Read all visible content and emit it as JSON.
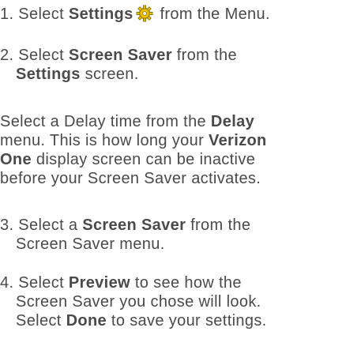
{
  "step1": {
    "prefix": "1. Select ",
    "bold": "Settings",
    "icon": "gear-icon",
    "suffix": " from the Menu."
  },
  "step2": {
    "line1_prefix": "2. Select ",
    "line1_bold": "Screen Saver",
    "line1_suffix": " from the",
    "line2_bold": "Settings",
    "line2_suffix": " screen."
  },
  "paragraph": {
    "l1_prefix": "Select a Delay time from the ",
    "l1_bold": "Delay",
    "l2_prefix": "menu. This is how long your ",
    "l2_bold": "Verizon",
    "l3_bold": "One",
    "l3_suffix": " display screen can be inactive",
    "l4": "before your Screen Saver activates."
  },
  "step3": {
    "line1_prefix": "3. Select a ",
    "line1_bold": "Screen Saver",
    "line1_suffix": " from the",
    "line2": "Screen Saver menu."
  },
  "step4": {
    "line1_prefix": "4. Select ",
    "line1_bold": "Preview",
    "line1_suffix": " to see how the",
    "line2": "Screen Saver you chose will look.",
    "line3_prefix": "Select ",
    "line3_bold": "Done",
    "line3_suffix": " to save your settings."
  },
  "colors": {
    "text": "#4a4a4a",
    "icon_fill": "#f2c200",
    "icon_outline": "#7a6a00"
  }
}
